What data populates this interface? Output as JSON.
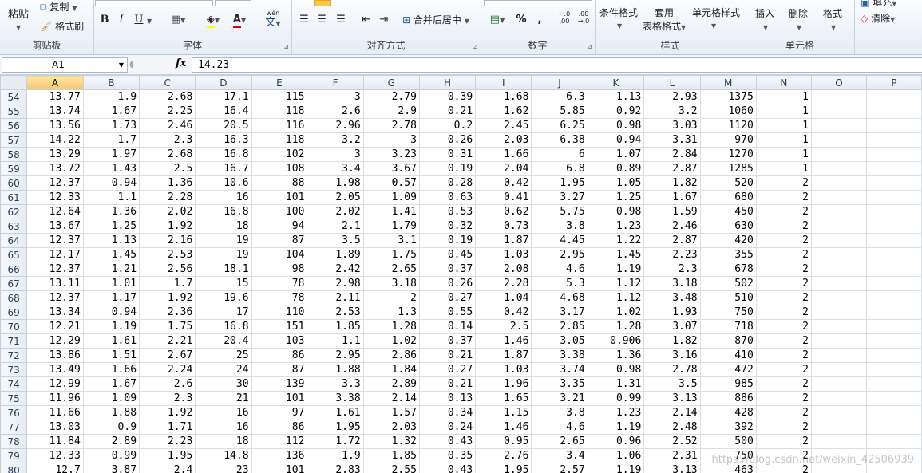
{
  "ribbon": {
    "clipboard": {
      "paste": "粘贴",
      "copy": "复制",
      "format_painter": "格式刷",
      "title": "剪贴板"
    },
    "font": {
      "bold": "B",
      "italic": "I",
      "underline": "U",
      "font_color": "A",
      "phonetic": "wén",
      "phonetic_char": "文",
      "title": "字体"
    },
    "alignment": {
      "merge_center": "合并后居中",
      "title": "对齐方式"
    },
    "number": {
      "percent": "%",
      "comma": ",",
      "inc_decimal": ".0\n.00",
      "dec_decimal": ".00\n.0",
      "title": "数字"
    },
    "styles": {
      "conditional": "条件格式",
      "table_fmt_1": "套用",
      "table_fmt_2": "表格格式",
      "cell_styles": "单元格样式",
      "title": "样式"
    },
    "cells": {
      "insert": "插入",
      "delete": "删除",
      "format": "格式",
      "title": "单元格"
    },
    "editing": {
      "fill": "填充",
      "clear": "清除"
    }
  },
  "formula_bar": {
    "name_box": "A1",
    "fx": "fx",
    "formula": "14.23"
  },
  "columns": [
    "A",
    "B",
    "C",
    "D",
    "E",
    "F",
    "G",
    "H",
    "I",
    "J",
    "K",
    "L",
    "M",
    "N",
    "O",
    "P"
  ],
  "selected_column": "A",
  "rows": [
    {
      "n": "54",
      "c": [
        "13.77",
        "1.9",
        "2.68",
        "17.1",
        "115",
        "3",
        "2.79",
        "0.39",
        "1.68",
        "6.3",
        "1.13",
        "2.93",
        "1375",
        "1"
      ]
    },
    {
      "n": "55",
      "c": [
        "13.74",
        "1.67",
        "2.25",
        "16.4",
        "118",
        "2.6",
        "2.9",
        "0.21",
        "1.62",
        "5.85",
        "0.92",
        "3.2",
        "1060",
        "1"
      ]
    },
    {
      "n": "56",
      "c": [
        "13.56",
        "1.73",
        "2.46",
        "20.5",
        "116",
        "2.96",
        "2.78",
        "0.2",
        "2.45",
        "6.25",
        "0.98",
        "3.03",
        "1120",
        "1"
      ]
    },
    {
      "n": "57",
      "c": [
        "14.22",
        "1.7",
        "2.3",
        "16.3",
        "118",
        "3.2",
        "3",
        "0.26",
        "2.03",
        "6.38",
        "0.94",
        "3.31",
        "970",
        "1"
      ]
    },
    {
      "n": "58",
      "c": [
        "13.29",
        "1.97",
        "2.68",
        "16.8",
        "102",
        "3",
        "3.23",
        "0.31",
        "1.66",
        "6",
        "1.07",
        "2.84",
        "1270",
        "1"
      ]
    },
    {
      "n": "59",
      "c": [
        "13.72",
        "1.43",
        "2.5",
        "16.7",
        "108",
        "3.4",
        "3.67",
        "0.19",
        "2.04",
        "6.8",
        "0.89",
        "2.87",
        "1285",
        "1"
      ]
    },
    {
      "n": "60",
      "c": [
        "12.37",
        "0.94",
        "1.36",
        "10.6",
        "88",
        "1.98",
        "0.57",
        "0.28",
        "0.42",
        "1.95",
        "1.05",
        "1.82",
        "520",
        "2"
      ]
    },
    {
      "n": "61",
      "c": [
        "12.33",
        "1.1",
        "2.28",
        "16",
        "101",
        "2.05",
        "1.09",
        "0.63",
        "0.41",
        "3.27",
        "1.25",
        "1.67",
        "680",
        "2"
      ]
    },
    {
      "n": "62",
      "c": [
        "12.64",
        "1.36",
        "2.02",
        "16.8",
        "100",
        "2.02",
        "1.41",
        "0.53",
        "0.62",
        "5.75",
        "0.98",
        "1.59",
        "450",
        "2"
      ]
    },
    {
      "n": "63",
      "c": [
        "13.67",
        "1.25",
        "1.92",
        "18",
        "94",
        "2.1",
        "1.79",
        "0.32",
        "0.73",
        "3.8",
        "1.23",
        "2.46",
        "630",
        "2"
      ]
    },
    {
      "n": "64",
      "c": [
        "12.37",
        "1.13",
        "2.16",
        "19",
        "87",
        "3.5",
        "3.1",
        "0.19",
        "1.87",
        "4.45",
        "1.22",
        "2.87",
        "420",
        "2"
      ]
    },
    {
      "n": "65",
      "c": [
        "12.17",
        "1.45",
        "2.53",
        "19",
        "104",
        "1.89",
        "1.75",
        "0.45",
        "1.03",
        "2.95",
        "1.45",
        "2.23",
        "355",
        "2"
      ]
    },
    {
      "n": "66",
      "c": [
        "12.37",
        "1.21",
        "2.56",
        "18.1",
        "98",
        "2.42",
        "2.65",
        "0.37",
        "2.08",
        "4.6",
        "1.19",
        "2.3",
        "678",
        "2"
      ]
    },
    {
      "n": "67",
      "c": [
        "13.11",
        "1.01",
        "1.7",
        "15",
        "78",
        "2.98",
        "3.18",
        "0.26",
        "2.28",
        "5.3",
        "1.12",
        "3.18",
        "502",
        "2"
      ]
    },
    {
      "n": "68",
      "c": [
        "12.37",
        "1.17",
        "1.92",
        "19.6",
        "78",
        "2.11",
        "2",
        "0.27",
        "1.04",
        "4.68",
        "1.12",
        "3.48",
        "510",
        "2"
      ]
    },
    {
      "n": "69",
      "c": [
        "13.34",
        "0.94",
        "2.36",
        "17",
        "110",
        "2.53",
        "1.3",
        "0.55",
        "0.42",
        "3.17",
        "1.02",
        "1.93",
        "750",
        "2"
      ]
    },
    {
      "n": "70",
      "c": [
        "12.21",
        "1.19",
        "1.75",
        "16.8",
        "151",
        "1.85",
        "1.28",
        "0.14",
        "2.5",
        "2.85",
        "1.28",
        "3.07",
        "718",
        "2"
      ]
    },
    {
      "n": "71",
      "c": [
        "12.29",
        "1.61",
        "2.21",
        "20.4",
        "103",
        "1.1",
        "1.02",
        "0.37",
        "1.46",
        "3.05",
        "0.906",
        "1.82",
        "870",
        "2"
      ]
    },
    {
      "n": "72",
      "c": [
        "13.86",
        "1.51",
        "2.67",
        "25",
        "86",
        "2.95",
        "2.86",
        "0.21",
        "1.87",
        "3.38",
        "1.36",
        "3.16",
        "410",
        "2"
      ]
    },
    {
      "n": "73",
      "c": [
        "13.49",
        "1.66",
        "2.24",
        "24",
        "87",
        "1.88",
        "1.84",
        "0.27",
        "1.03",
        "3.74",
        "0.98",
        "2.78",
        "472",
        "2"
      ]
    },
    {
      "n": "74",
      "c": [
        "12.99",
        "1.67",
        "2.6",
        "30",
        "139",
        "3.3",
        "2.89",
        "0.21",
        "1.96",
        "3.35",
        "1.31",
        "3.5",
        "985",
        "2"
      ]
    },
    {
      "n": "75",
      "c": [
        "11.96",
        "1.09",
        "2.3",
        "21",
        "101",
        "3.38",
        "2.14",
        "0.13",
        "1.65",
        "3.21",
        "0.99",
        "3.13",
        "886",
        "2"
      ]
    },
    {
      "n": "76",
      "c": [
        "11.66",
        "1.88",
        "1.92",
        "16",
        "97",
        "1.61",
        "1.57",
        "0.34",
        "1.15",
        "3.8",
        "1.23",
        "2.14",
        "428",
        "2"
      ]
    },
    {
      "n": "77",
      "c": [
        "13.03",
        "0.9",
        "1.71",
        "16",
        "86",
        "1.95",
        "2.03",
        "0.24",
        "1.46",
        "4.6",
        "1.19",
        "2.48",
        "392",
        "2"
      ]
    },
    {
      "n": "78",
      "c": [
        "11.84",
        "2.89",
        "2.23",
        "18",
        "112",
        "1.72",
        "1.32",
        "0.43",
        "0.95",
        "2.65",
        "0.96",
        "2.52",
        "500",
        "2"
      ]
    },
    {
      "n": "79",
      "c": [
        "12.33",
        "0.99",
        "1.95",
        "14.8",
        "136",
        "1.9",
        "1.85",
        "0.35",
        "2.76",
        "3.4",
        "1.06",
        "2.31",
        "750",
        "2"
      ]
    },
    {
      "n": "80",
      "c": [
        "12.7",
        "3.87",
        "2.4",
        "23",
        "101",
        "2.83",
        "2.55",
        "0.43",
        "1.95",
        "2.57",
        "1.19",
        "3.13",
        "463",
        "2"
      ]
    }
  ],
  "watermark": "https://blog.csdn.net/weixin_42506939"
}
